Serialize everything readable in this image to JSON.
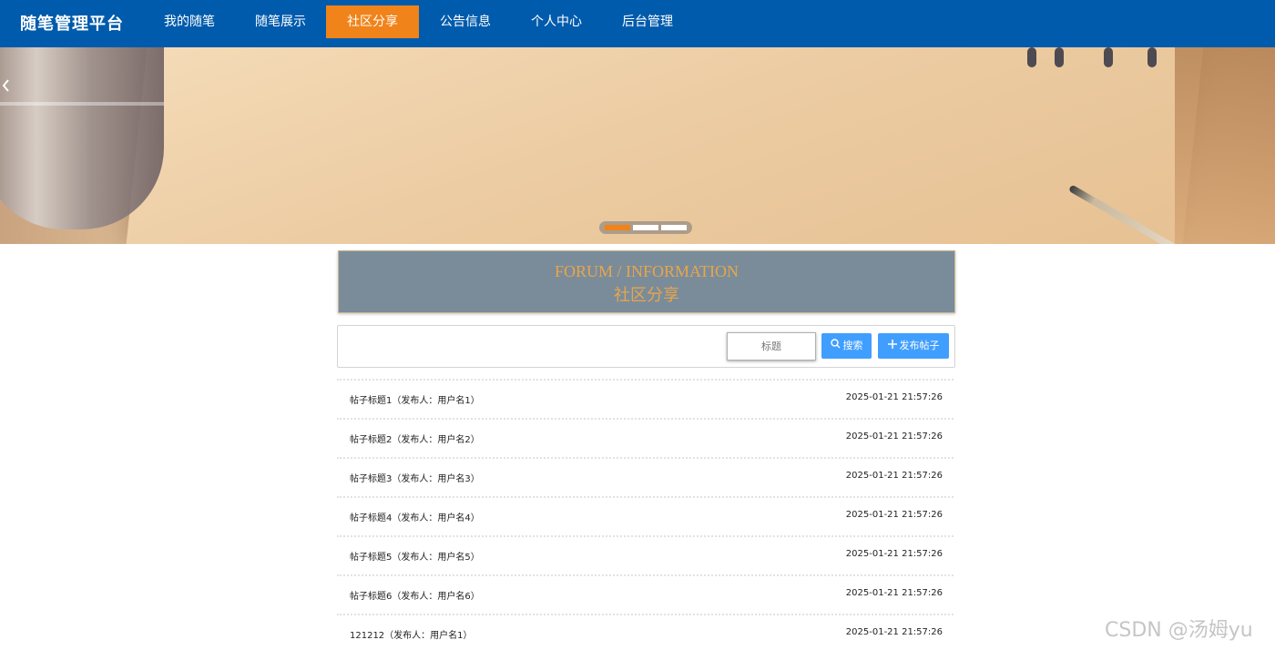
{
  "header": {
    "brand": "随笔管理平台",
    "nav": [
      {
        "label": "我的随笔",
        "active": false
      },
      {
        "label": "随笔展示",
        "active": false
      },
      {
        "label": "社区分享",
        "active": true
      },
      {
        "label": "公告信息",
        "active": false
      },
      {
        "label": "个人中心",
        "active": false
      },
      {
        "label": "后台管理",
        "active": false
      }
    ],
    "bg_color": "#005bac",
    "active_color": "#f08319"
  },
  "banner": {
    "prev_icon": "chevron-left-icon",
    "slides_total": 3,
    "active_slide": 1
  },
  "section": {
    "title_en": "FORUM / INFORMATION",
    "title_cn": "社区分享"
  },
  "search": {
    "placeholder": "标题",
    "search_label": "搜索",
    "publish_label": "发布帖子",
    "button_color": "#409eff"
  },
  "posts": [
    {
      "title": "帖子标题1（发布人：用户名1）",
      "time": "2025-01-21 21:57:26"
    },
    {
      "title": "帖子标题2（发布人：用户名2）",
      "time": "2025-01-21 21:57:26"
    },
    {
      "title": "帖子标题3（发布人：用户名3）",
      "time": "2025-01-21 21:57:26"
    },
    {
      "title": "帖子标题4（发布人：用户名4）",
      "time": "2025-01-21 21:57:26"
    },
    {
      "title": "帖子标题5（发布人：用户名5）",
      "time": "2025-01-21 21:57:26"
    },
    {
      "title": "帖子标题6（发布人：用户名6）",
      "time": "2025-01-21 21:57:26"
    },
    {
      "title": "121212（发布人：用户名1）",
      "time": "2025-01-21 21:57:26"
    }
  ],
  "watermark": "CSDN @汤姆yu"
}
